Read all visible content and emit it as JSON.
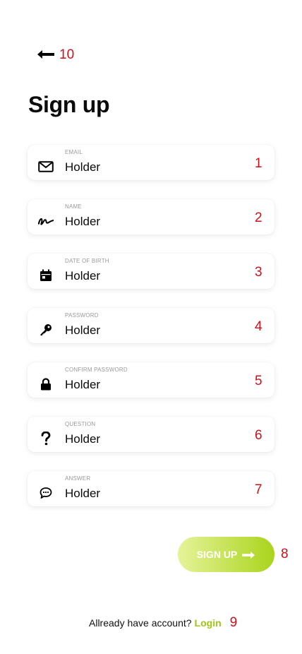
{
  "header": {
    "back_icon": "arrow-left-icon",
    "back_annotation": "10"
  },
  "page": {
    "title": "Sign up"
  },
  "fields": [
    {
      "label": "EMAIL",
      "value": "Holder",
      "icon": "envelope-icon",
      "annotation": "1"
    },
    {
      "label": "NAME",
      "value": "Holder",
      "icon": "signature-icon",
      "annotation": "2"
    },
    {
      "label": "DATE OF BIRTH",
      "value": "Holder",
      "icon": "calendar-icon",
      "annotation": "3"
    },
    {
      "label": "PASSWORD",
      "value": "Holder",
      "icon": "key-icon",
      "annotation": "4"
    },
    {
      "label": "CONFIRM PASSWORD",
      "value": "Holder",
      "icon": "lock-icon",
      "annotation": "5"
    },
    {
      "label": "QUESTION",
      "value": "Holder",
      "icon": "question-mark-icon",
      "annotation": "6"
    },
    {
      "label": "ANSWER",
      "value": "Holder",
      "icon": "chat-bubble-icon",
      "annotation": "7"
    }
  ],
  "signup_button": {
    "label": "SIGN UP",
    "icon": "arrow-right-icon",
    "annotation": "8"
  },
  "footer": {
    "prompt": "Allready have account?",
    "login_label": "Login",
    "annotation": "9"
  },
  "colors": {
    "accent": "#9bc613",
    "button_gradient_start": "#e6f39a",
    "button_gradient_end": "#a9d41c",
    "annotation": "#d10f1b"
  }
}
